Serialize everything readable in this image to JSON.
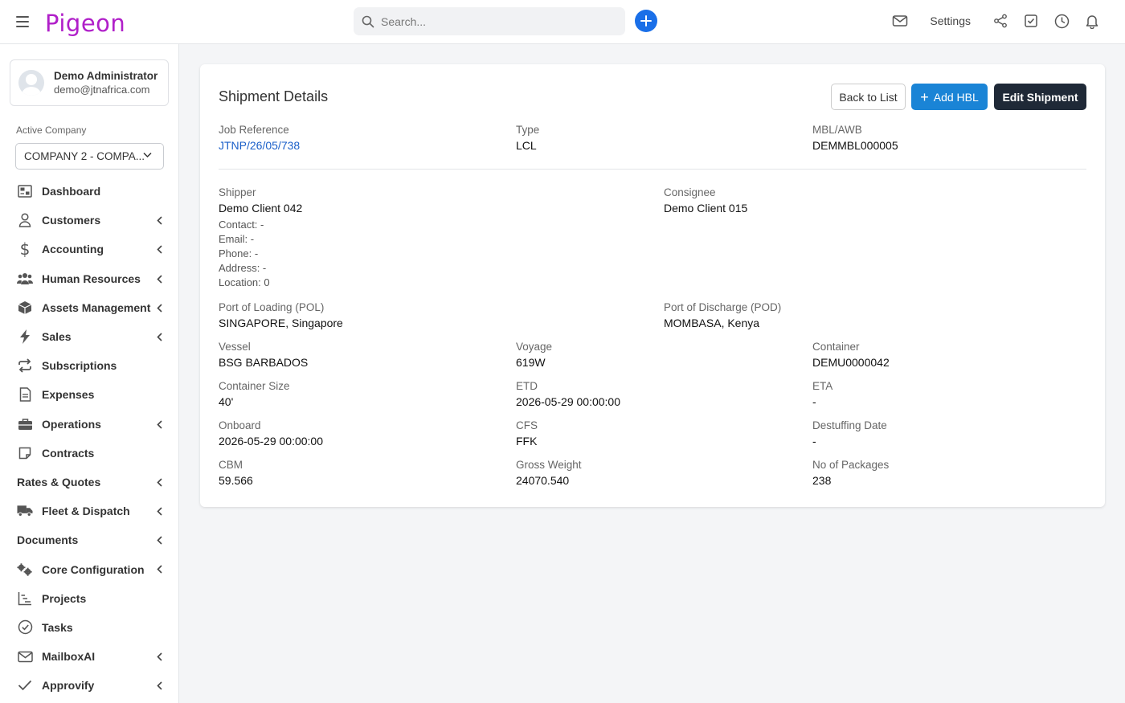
{
  "app": {
    "logo": "Pigeon"
  },
  "topbar": {
    "search_placeholder": "Search...",
    "settings_label": "Settings"
  },
  "user": {
    "name": "Demo Administrator",
    "email": "demo@jtnafrica.com"
  },
  "company": {
    "label": "Active Company",
    "selected": "COMPANY 2 - COMPA..."
  },
  "nav": [
    {
      "label": "Dashboard",
      "icon": "dashboard-icon",
      "expandable": false
    },
    {
      "label": "Customers",
      "icon": "user-icon",
      "expandable": true
    },
    {
      "label": "Accounting",
      "icon": "dollar-icon",
      "expandable": true
    },
    {
      "label": "Human Resources",
      "icon": "people-icon",
      "expandable": true
    },
    {
      "label": "Assets Management",
      "icon": "box-icon",
      "expandable": true
    },
    {
      "label": "Sales",
      "icon": "bolt-icon",
      "expandable": true
    },
    {
      "label": "Subscriptions",
      "icon": "repeat-icon",
      "expandable": false
    },
    {
      "label": "Expenses",
      "icon": "document-icon",
      "expandable": false
    },
    {
      "label": "Operations",
      "icon": "briefcase-icon",
      "expandable": true
    },
    {
      "label": "Contracts",
      "icon": "note-icon",
      "expandable": false
    },
    {
      "label": "Rates & Quotes",
      "icon": "",
      "expandable": true
    },
    {
      "label": "Fleet & Dispatch",
      "icon": "truck-icon",
      "expandable": true
    },
    {
      "label": "Documents",
      "icon": "",
      "expandable": true
    },
    {
      "label": "Core Configuration",
      "icon": "gears-icon",
      "expandable": true
    },
    {
      "label": "Projects",
      "icon": "chart-icon",
      "expandable": false
    },
    {
      "label": "Tasks",
      "icon": "check-circle-icon",
      "expandable": false
    },
    {
      "label": "MailboxAI",
      "icon": "mail-icon",
      "expandable": true
    },
    {
      "label": "Approvify",
      "icon": "check-icon",
      "expandable": true
    }
  ],
  "card": {
    "title": "Shipment Details",
    "buttons": {
      "back": "Back to List",
      "add_hbl": "Add HBL",
      "edit": "Edit Shipment"
    },
    "job_reference": {
      "label": "Job Reference",
      "value": "JTNP/26/05/738"
    },
    "type": {
      "label": "Type",
      "value": "LCL"
    },
    "mbl": {
      "label": "MBL/AWB",
      "value": "DEMMBL000005"
    },
    "shipper": {
      "label": "Shipper",
      "value": "Demo Client 042",
      "contact": "Contact: -",
      "email": "Email: -",
      "phone": "Phone: -",
      "address": "Address: -",
      "location": "Location: 0"
    },
    "consignee": {
      "label": "Consignee",
      "value": "Demo Client 015"
    },
    "pol": {
      "label": "Port of Loading (POL)",
      "value": "SINGAPORE, Singapore"
    },
    "pod": {
      "label": "Port of Discharge (POD)",
      "value": "MOMBASA, Kenya"
    },
    "vessel": {
      "label": "Vessel",
      "value": "BSG BARBADOS"
    },
    "voyage": {
      "label": "Voyage",
      "value": "619W"
    },
    "container": {
      "label": "Container",
      "value": "DEMU0000042"
    },
    "container_size": {
      "label": "Container Size",
      "value": "40'"
    },
    "etd": {
      "label": "ETD",
      "value": "2026-05-29 00:00:00"
    },
    "eta": {
      "label": "ETA",
      "value": "-"
    },
    "onboard": {
      "label": "Onboard",
      "value": "2026-05-29 00:00:00"
    },
    "cfs": {
      "label": "CFS",
      "value": "FFK"
    },
    "destuffing": {
      "label": "Destuffing Date",
      "value": "-"
    },
    "cbm": {
      "label": "CBM",
      "value": "59.566"
    },
    "gross_weight": {
      "label": "Gross Weight",
      "value": "24070.540"
    },
    "packages": {
      "label": "No of Packages",
      "value": "238"
    }
  },
  "colors": {
    "brand": "#b01fc9",
    "primary": "#1a84d6",
    "dark": "#1f2937",
    "link": "#1a5fc9"
  }
}
